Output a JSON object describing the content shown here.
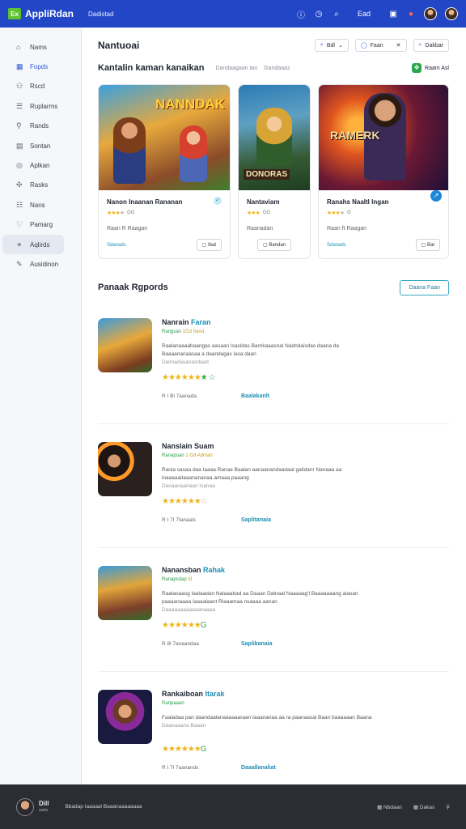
{
  "app": {
    "logo": "Ex",
    "name": "AppliRdan",
    "nav": "Dadistad"
  },
  "topbar": {
    "icons": [
      "info-icon",
      "clock-icon",
      "search-icon"
    ],
    "label": "Ead"
  },
  "sidebar": {
    "items": [
      {
        "label": "Nams",
        "icon": "home-icon"
      },
      {
        "label": "Fopds",
        "icon": "grid-icon"
      },
      {
        "label": "Rscd",
        "icon": "user-icon"
      },
      {
        "label": "Ruplarms",
        "icon": "list-icon"
      },
      {
        "label": "Rands",
        "icon": "person-icon"
      },
      {
        "label": "Sontan",
        "icon": "doc-icon"
      },
      {
        "label": "Aplkan",
        "icon": "circle-icon"
      },
      {
        "label": "Rasks",
        "icon": "tag-icon"
      },
      {
        "label": "Nans",
        "icon": "layers-icon"
      },
      {
        "label": "Pamarg",
        "icon": "heart-icon"
      },
      {
        "label": "Aqlirds",
        "icon": "chat-icon"
      },
      {
        "label": "Ausidinon",
        "icon": "pen-icon"
      }
    ]
  },
  "header": {
    "title": "Nantuoai",
    "search_label": "Bdl",
    "chip2_label": "Faan",
    "chip3_label": "Dakbar"
  },
  "featured": {
    "title": "Kantalin kaman kanaikan",
    "meta1": "Dandaagaan tan",
    "meta2": "Gandaaaz",
    "right_label": "Raam Asl",
    "cards": [
      {
        "title": "Nanon Inaanan Rananan",
        "art_text": "NANNDAK",
        "stars": "★★★",
        "faint": "★",
        "meta": "GG",
        "desc": "Raan R Raagan",
        "link": "Sdanads",
        "button": "Ibat"
      },
      {
        "title": "Nantaviam",
        "art_text": "DONORAS",
        "stars": "★★★",
        "faint": "",
        "meta": "GG",
        "desc": "Raanadan",
        "link": "",
        "button": "Bandan"
      },
      {
        "title": "Ranahs Naaltl Ingan",
        "art_text": "RAMERK",
        "stars": "★★★",
        "faint": "★",
        "meta": "G",
        "desc": "Raan ft Raagan",
        "link": "Sdanads",
        "button": "Bat"
      }
    ]
  },
  "section": {
    "title": "Panaak Rgpords",
    "button": "Daana Faan"
  },
  "list": [
    {
      "name": "Nanrain",
      "tag": "Faran",
      "cat": "Rangsan",
      "cat2": "1Gd Itand",
      "desc": "Raalanaaaabaangas aasaan Isasldas Barnkaaasnal Nadndaisdas daana da Baaaananaasaa a daandagas lasa daan",
      "desc2": "Dalmadasanasdaad",
      "stars": "★★★★★★",
      "extra": "★ ☆",
      "meta": "R I Bl 7aanada",
      "link": "Baalakanlt"
    },
    {
      "name": "Nanslain Suam",
      "tag": "",
      "cat": "Ranapoan",
      "cat2": "1 Gd Adman",
      "desc": "Rania sasaa daa Iaaaa Ranae Baalan aanaanandaadaal galidanr Nanaaa aa inaaaaaiIaaanananaa amaaa paaang",
      "desc2": "Danaanaanaan Isanaa",
      "stars": "★★★★★★",
      "extra": "☆",
      "meta": "R I 7I 7Ianaais",
      "link": "Saplitanaia"
    },
    {
      "name": "Nanansban",
      "tag": "Rahak",
      "cat": "Ranapsdap",
      "cat2": "Id",
      "desc": "Raalaoaasg Iaalaadan Nalaaabad aa Daaan Dalnaal Naaaaag'l Baaaaaaang alasan paaaanaaaa Iaaaalaant Rlaaamaa nsaaaa aanan",
      "desc2": "Daaaaaaaaaaaanaaaa",
      "stars": "★★★★★★",
      "extra": "G",
      "meta": "R 8l 7anaandaa",
      "link": "Saplikanaia"
    },
    {
      "name": "Rankaiboan",
      "tag": "Itarak",
      "cat": "Ranpaaan",
      "cat2": "",
      "desc": "Faaladaa pan daandaalanaaaaaaraan Iaaananaa aa ra paanaasal Baan baaaaaan Baana",
      "desc2": "Daanaaana Baaan",
      "stars": "★★★★★★",
      "extra": "G",
      "meta": "R I 7l 7aanands",
      "link": "Daaallanaliat"
    }
  ],
  "footer": {
    "name": "Dill",
    "handle": "aada",
    "text": "Bbadap Iaaaaal Baaanaaaaaaaa",
    "right1": "Nbdaan",
    "right2": "Dakas"
  }
}
